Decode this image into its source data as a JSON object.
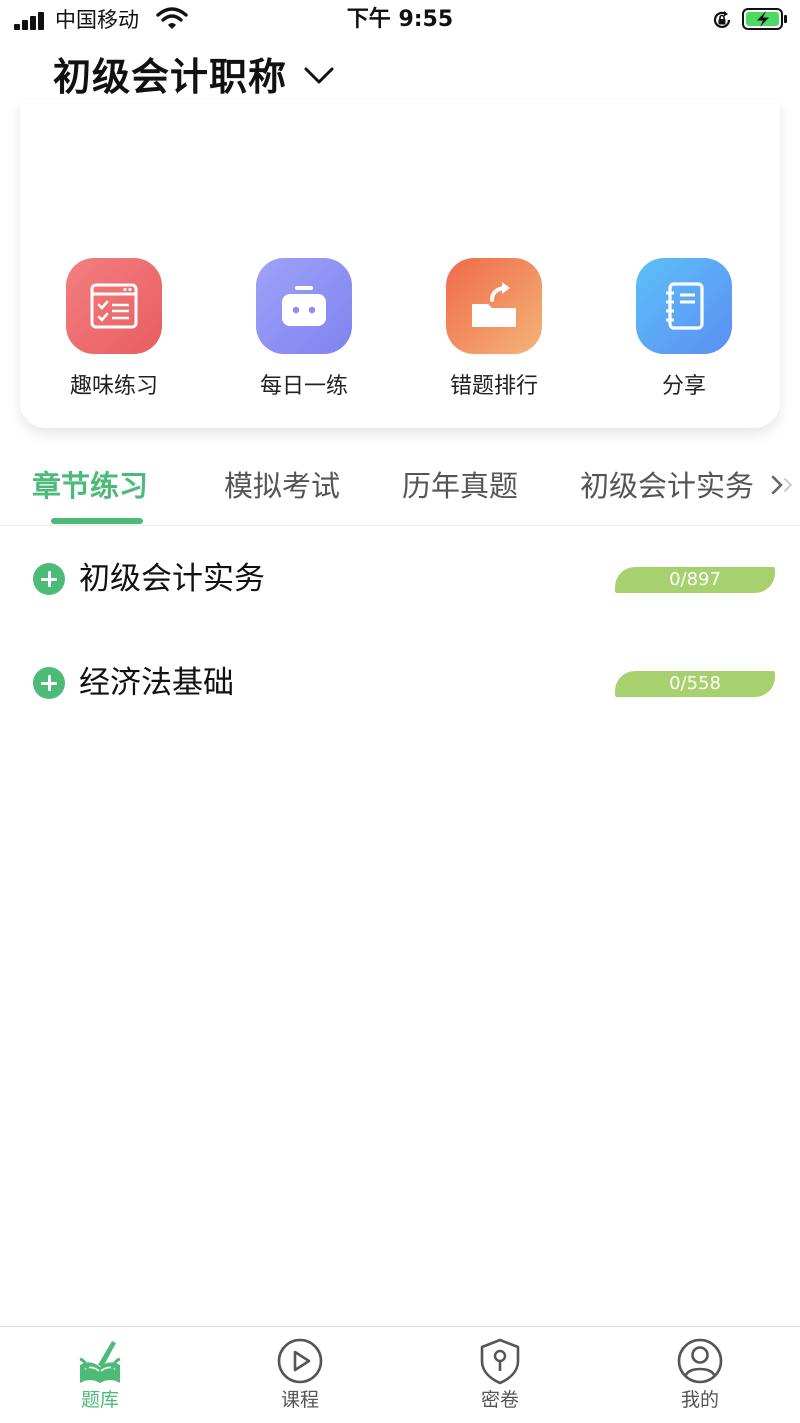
{
  "status_bar": {
    "carrier": "中国移动",
    "time": "下午 9:55"
  },
  "header": {
    "title": "初级会计职称"
  },
  "features": [
    {
      "label": "趣味练习",
      "icon": "checklist-icon",
      "color": "#ee6b6b"
    },
    {
      "label": "每日一练",
      "icon": "robot-icon",
      "color": "#8f8ff4"
    },
    {
      "label": "错题排行",
      "icon": "folder-share-icon",
      "color": "#f08a55"
    },
    {
      "label": "分享",
      "icon": "notebook-icon",
      "color": "#5aa4f5"
    }
  ],
  "tabs": [
    {
      "label": "章节练习",
      "active": true
    },
    {
      "label": "模拟考试",
      "active": false
    },
    {
      "label": "历年真题",
      "active": false
    },
    {
      "label": "初级会计实务",
      "active": false
    }
  ],
  "subjects": [
    {
      "label": "初级会计实务",
      "progress": "0/897"
    },
    {
      "label": "经济法基础",
      "progress": "0/558"
    }
  ],
  "bottom_nav": [
    {
      "label": "题库",
      "icon": "book-pen-icon",
      "active": true
    },
    {
      "label": "课程",
      "icon": "play-circle-icon",
      "active": false
    },
    {
      "label": "密卷",
      "icon": "shield-key-icon",
      "active": false
    },
    {
      "label": "我的",
      "icon": "user-icon",
      "active": false
    }
  ],
  "colors": {
    "accent": "#4cbb78",
    "progress": "#a7d16e"
  }
}
